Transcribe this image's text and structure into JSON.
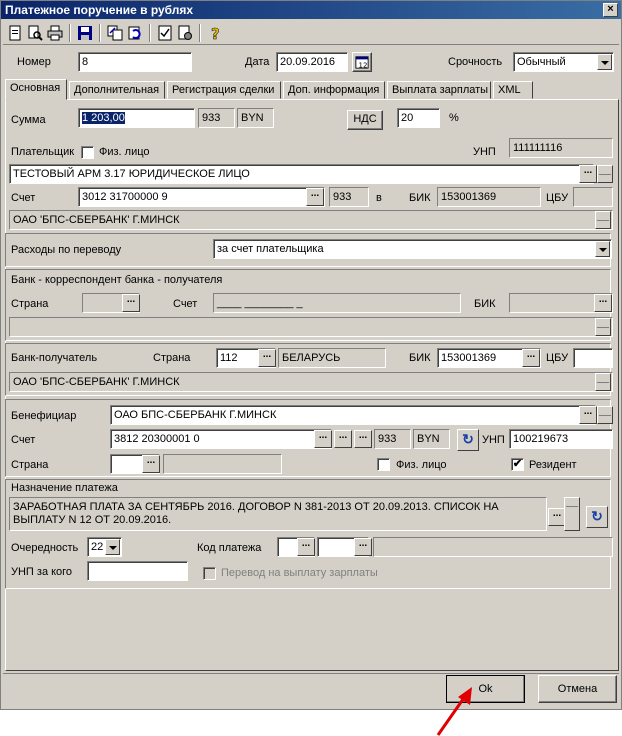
{
  "window": {
    "title": "Платежное поручение в рублях"
  },
  "toolbar": {
    "icons": [
      "new-doc",
      "preview",
      "print",
      "save",
      "copy",
      "refresh",
      "check",
      "settings",
      "help"
    ]
  },
  "header": {
    "number_label": "Номер",
    "number_value": "8",
    "date_label": "Дата",
    "date_value": "20.09.2016",
    "urgency_label": "Срочность",
    "urgency_value": "Обычный"
  },
  "tabs": [
    "Основная",
    "Дополнительная",
    "Регистрация сделки",
    "Доп. информация",
    "Выплата зарплаты",
    "XML"
  ],
  "sum": {
    "label": "Сумма",
    "value": "1 203,00",
    "code": "933",
    "currency": "BYN",
    "vat_button": "НДС",
    "vat_value": "20",
    "percent": "%"
  },
  "payer": {
    "label": "Плательщик",
    "physical_label": "Физ. лицо",
    "unp_label": "УНП",
    "unp_value": "111111116",
    "name": "ТЕСТОВЫЙ АРМ 3.17 ЮРИДИЧЕСКОЕ ЛИЦО",
    "account_label": "Счет",
    "account_value": "3012 31700000 9",
    "account_code": "933",
    "in_label": "в",
    "bik_label": "БИК",
    "bik_value": "153001369",
    "cbu_label": "ЦБУ",
    "bank_name": "ОАО 'БПС-СБЕРБАНК' Г.МИНСК"
  },
  "expenses": {
    "label": "Расходы по переводу",
    "value": "за счет плательщика"
  },
  "corr_bank": {
    "title": "Банк - корреспондент банка - получателя",
    "country_label": "Страна",
    "account_label": "Счет",
    "account_value": "____ ________ _",
    "bik_label": "БИК"
  },
  "recipient_bank": {
    "label": "Банк-получатель",
    "country_label": "Страна",
    "country_code": "112",
    "country_name": "БЕЛАРУСЬ",
    "bik_label": "БИК",
    "bik_value": "153001369",
    "cbu_label": "ЦБУ",
    "name": "ОАО 'БПС-СБЕРБАНК' Г.МИНСК"
  },
  "beneficiary": {
    "label": "Бенефициар",
    "name": "ОАО БПС-СБЕРБАНК Г.МИНСК",
    "account_label": "Счет",
    "account_value": "3812 20300001 0",
    "account_code": "933",
    "currency": "BYN",
    "unp_label": "УНП",
    "unp_value": "100219673",
    "country_label": "Страна",
    "physical_label": "Физ. лицо",
    "resident_label": "Резидент",
    "resident_checked": "✔"
  },
  "purpose": {
    "title": "Назначение платежа",
    "line1": "ЗАРАБОТНАЯ ПЛАТА ЗА СЕНТЯБРЬ 2016. ДОГОВОР N 381-2013 ОТ 20.09.2013.  СПИСОК НА",
    "line2": "ВЫПЛАТУ N 12 ОТ 20.09.2016.",
    "priority_label": "Очередность",
    "priority_value": "22",
    "code_label": "Код платежа",
    "unp_for_label": "УНП за кого",
    "salary_label": "Перевод на выплату зарплаты"
  },
  "footer": {
    "ok": "Ok",
    "cancel": "Отмена"
  },
  "colors": {
    "title_bar": "#0a246a",
    "window_bg": "#d4d0c8",
    "arrow": "#e00000"
  }
}
